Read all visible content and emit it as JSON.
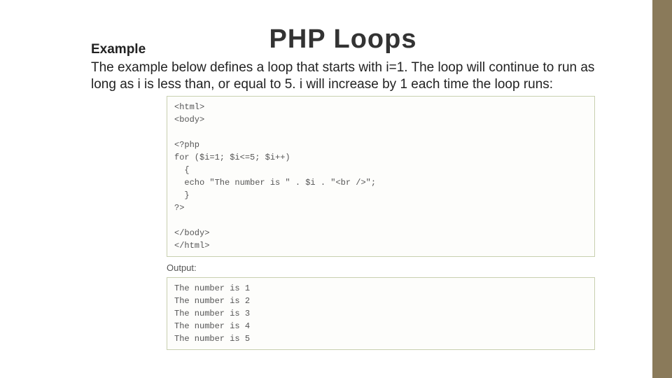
{
  "title": "PHP Loops",
  "example_label": "Example",
  "description": "The example below defines a loop that starts with i=1. The loop will continue to run as long as i is less than, or equal to 5. i will increase by 1 each time the loop runs:",
  "code": "<html>\n<body>\n\n<?php\nfor ($i=1; $i<=5; $i++)\n  {\n  echo \"The number is \" . $i . \"<br />\";\n  }\n?>\n\n</body>\n</html>",
  "output_label": "Output:",
  "output": "The number is 1\nThe number is 2\nThe number is 3\nThe number is 4\nThe number is 5"
}
